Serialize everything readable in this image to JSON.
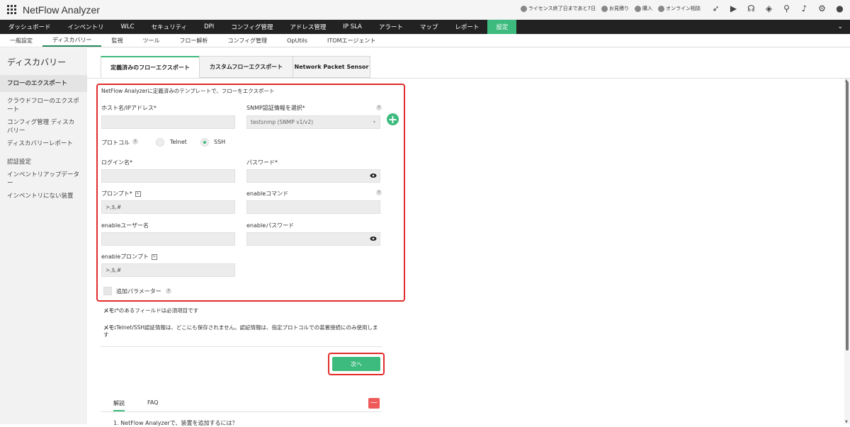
{
  "app": {
    "title": "NetFlow Analyzer"
  },
  "top_bar": {
    "license": "ライセンス終了日まであと7日",
    "quote": "お見積り",
    "buy": "購入",
    "online": "オンライン相談"
  },
  "main_nav": [
    "ダッシュボード",
    "インベントリ",
    "WLC",
    "セキュリティ",
    "DPI",
    "コンフィグ管理",
    "アドレス管理",
    "IP SLA",
    "アラート",
    "マップ",
    "レポート",
    "設定"
  ],
  "main_nav_active": "設定",
  "sub_nav": [
    "一般設定",
    "ディスカバリー",
    "監視",
    "ツール",
    "フロー解析",
    "コンフィグ管理",
    "OpUtils",
    "ITOMエージェント"
  ],
  "sub_nav_active": "ディスカバリー",
  "sidebar": {
    "title": "ディスカバリー",
    "items": [
      "フローのエクスポート",
      "クラウドフローのエクスポート",
      "コンフィグ管理 ディスカバリー",
      "ディスカバリーレポート",
      "認証設定",
      "インベントリアップデーター",
      "インベントリにない装置"
    ]
  },
  "tabs": [
    "定義済みのフローエクスポート",
    "カスタムフローエクスポート",
    "Network Packet Sensor"
  ],
  "form": {
    "intro": "NetFlow Analyzerに定義済みのテンプレートで、フローをエクスポート",
    "host_label": "ホスト名/IPアドレス*",
    "host_value": "",
    "snmp_label": "SNMP認証情報を選択*",
    "snmp_value": "testsnmp (SNMP v1/v2)",
    "protocol_label": "プロトコル",
    "telnet_label": "Telnet",
    "ssh_label": "SSH",
    "protocol_selected": "SSH",
    "login_label": "ログイン名*",
    "password_label": "パスワード*",
    "prompt_label": "プロンプト*",
    "prompt_value": ">,$,#",
    "enable_cmd_label": "enableコマンド",
    "enable_user_label": "enableユーザー名",
    "enable_pass_label": "enableパスワード",
    "enable_prompt_label": "enableプロンプト",
    "enable_prompt_value": ">,$,#",
    "extra_params_label": "追加パラメーター"
  },
  "notes": {
    "note1_prefix": "メモ:",
    "note1": "*のあるフィールドは必須項目です",
    "note2_prefix": "メモ:",
    "note2": "Telnet/SSH認証情報は、どこにも保存されません。認証情報は、指定プロトコルでの装置接続にのみ使用しま",
    "note2_cont": "す"
  },
  "next_button": "次へ",
  "help": {
    "tabs": [
      "解説",
      "FAQ"
    ],
    "active": "解説",
    "first_item": "1. NetFlow Analyzerで、装置を追加するには？"
  },
  "colors": {
    "accent": "#3dbb7e",
    "highlight": "#e22b2b",
    "nav_bg": "#222222"
  }
}
